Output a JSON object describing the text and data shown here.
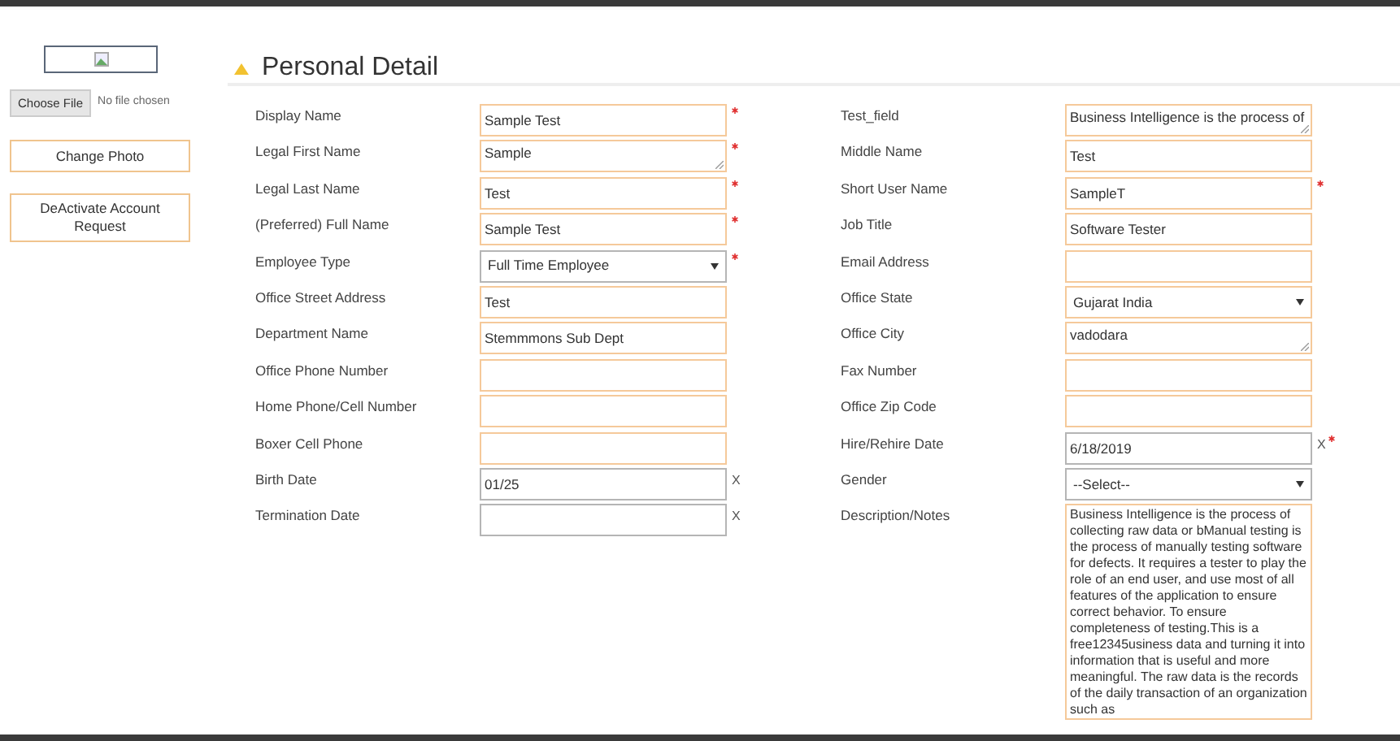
{
  "sidebar": {
    "file_button": "Choose File",
    "file_status": "No file chosen",
    "buttons": [
      "Change Photo",
      "DeActivate Account Request"
    ]
  },
  "section": {
    "title": "Personal Detail",
    "expanded": true
  },
  "left_fields": [
    {
      "label": "Display Name",
      "kind": "text",
      "value": "Sample Test",
      "required": true,
      "highlighted": true
    },
    {
      "label": "Legal First Name",
      "kind": "textarea",
      "value": "Sample",
      "required": true,
      "highlighted": true
    },
    {
      "label": "Legal Last Name",
      "kind": "text",
      "value": "Test",
      "required": true,
      "highlighted": true
    },
    {
      "label": "(Preferred) Full Name",
      "kind": "text",
      "value": "Sample Test",
      "required": true,
      "highlighted": true
    },
    {
      "label": "Employee Type",
      "kind": "select",
      "value": "Full Time Employee",
      "required": true,
      "highlighted": false
    },
    {
      "label": "Office Street Address",
      "kind": "text",
      "value": "Test",
      "required": false,
      "highlighted": true
    },
    {
      "label": "Department Name",
      "kind": "text",
      "value": "Stemmmons Sub Dept",
      "required": false,
      "highlighted": true
    },
    {
      "label": "Office Phone Number",
      "kind": "text",
      "required": false,
      "highlighted": true
    },
    {
      "label": "Home Phone/Cell Number",
      "kind": "text",
      "required": false,
      "highlighted": true
    },
    {
      "label": "Boxer Cell Phone",
      "kind": "text",
      "required": false,
      "highlighted": true
    },
    {
      "label": "Birth Date",
      "kind": "date",
      "value": "01/25",
      "clear": "X",
      "required": false,
      "highlighted": false
    },
    {
      "label": "Termination Date",
      "kind": "date",
      "clear": "X",
      "required": false,
      "highlighted": false
    }
  ],
  "right_fields": [
    {
      "label": "Test_field",
      "kind": "textarea",
      "value": "Business Intelligence is the process of",
      "required": false,
      "highlighted": true
    },
    {
      "label": "Middle Name",
      "kind": "text",
      "value": "Test",
      "required": false,
      "highlighted": true
    },
    {
      "label": "Short User Name",
      "kind": "text",
      "value": "SampleT",
      "required": true,
      "highlighted": true
    },
    {
      "label": "Job Title",
      "kind": "text",
      "value": "Software Tester",
      "required": false,
      "highlighted": true
    },
    {
      "label": "Email Address",
      "kind": "text",
      "required": false,
      "highlighted": true
    },
    {
      "label": "Office State",
      "kind": "select",
      "value": "Gujarat India",
      "required": false,
      "highlighted": true
    },
    {
      "label": "Office City",
      "kind": "textarea",
      "value": "vadodara",
      "required": false,
      "highlighted": true
    },
    {
      "label": "Fax Number",
      "kind": "text",
      "required": false,
      "highlighted": true
    },
    {
      "label": "Office Zip Code",
      "kind": "text",
      "required": false,
      "highlighted": true
    },
    {
      "label": "Hire/Rehire Date",
      "kind": "date",
      "value": "6/18/2019",
      "clear": "X",
      "required": true,
      "highlighted": false
    },
    {
      "label": "Gender",
      "kind": "select",
      "value": "--Select--",
      "required": false,
      "highlighted": false
    },
    {
      "label": "Description/Notes",
      "kind": "notes",
      "value": "Business Intelligence is the process of collecting raw data or bManual testing is the process of manually testing software for defects. It requires a tester to play the role of an end user, and use most of all features of the application to ensure correct behavior. To ensure completeness of testing.This is a free12345usiness data and turning it into information that is useful and more meaningful.  The raw data is the records of the daily transaction of an organization such as",
      "required": false,
      "highlighted": true
    }
  ]
}
